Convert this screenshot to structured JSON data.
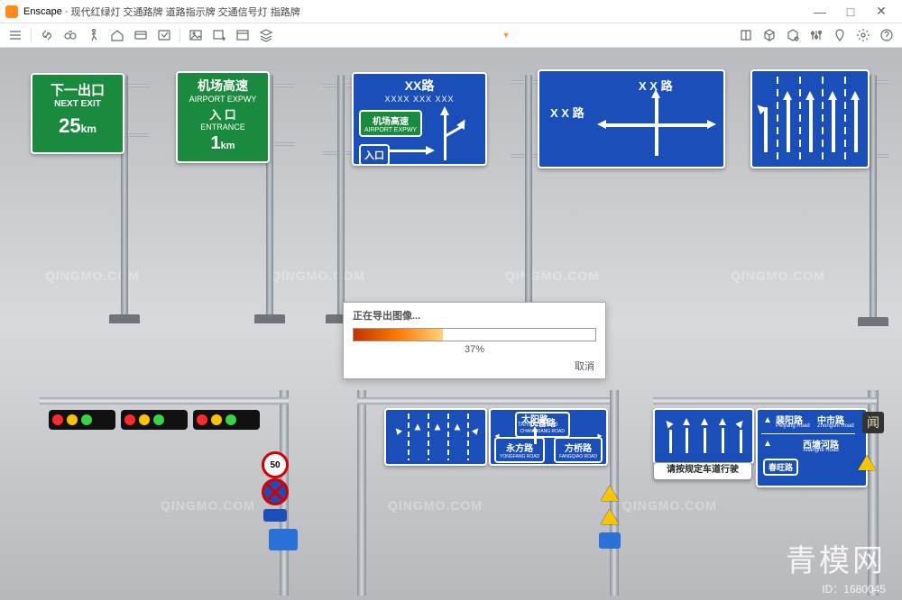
{
  "colors": {
    "green_sign": "#1a8a3e",
    "blue_sign": "#1a4eb8",
    "accent": "#ff8c1a"
  },
  "app": {
    "name": "Enscape",
    "title_suffix": "现代红绿灯 交通路牌 道路指示牌 交通信号灯 指路牌",
    "window_controls": {
      "min": "—",
      "max": "□",
      "close": "✕"
    }
  },
  "toolbar": {
    "left": [
      "menu",
      "link",
      "binoculars",
      "walk",
      "house",
      "card",
      "recent",
      "image",
      "image-plus",
      "window",
      "layers"
    ],
    "center_caret": "▾",
    "right": [
      "book",
      "cube",
      "cube-settings",
      "sliders",
      "pin",
      "gear",
      "help"
    ]
  },
  "dialog": {
    "title": "正在导出图像...",
    "percent_text": "37%",
    "percent_value": 37,
    "cancel": "取消"
  },
  "signs": {
    "s1": {
      "l1": "下一出口",
      "l2": "NEXT EXIT",
      "l3": "25",
      "unit": "km"
    },
    "s2": {
      "l1": "机场高速",
      "l2": "AIRPORT EXPWY",
      "l3": "入 口",
      "l4": "ENTRANCE",
      "l5": "1",
      "unit": "km"
    },
    "s3": {
      "title": "XX路",
      "sub": "XXXX  XXX  XXX",
      "box1_a": "机场高速",
      "box1_b": "AIRPORT  EXPWY",
      "box2": "入口"
    },
    "s4": {
      "top": "X X   路",
      "left": "X X   路"
    },
    "s5": {
      "lanes": 5
    },
    "g1": {
      "sun": "太阳路",
      "sun_en": "TAIYANG ROAD",
      "yf": "永方路",
      "yf_en": "YONGFANG ROAD",
      "fq": "方桥路",
      "fq_en": "FANGQIAO ROAD",
      "cx": "长香路",
      "cx_en": "CHANGXIANG ROAD"
    },
    "g2": {
      "p1": "裴阳路",
      "p1_en": "Peiyang Road",
      "p2": "中市路",
      "p2_en": "Zhongshi Road",
      "p3": "西塘河路",
      "p3_en": "Xitanghe Road",
      "cw": "春旺路",
      "note": "请按规定车道行驶",
      "letter": "闻"
    },
    "speed": "50"
  },
  "watermark": {
    "text": "QINGMO.COM",
    "brand": "青模网",
    "id_label": "ID：",
    "id": "1680045"
  }
}
